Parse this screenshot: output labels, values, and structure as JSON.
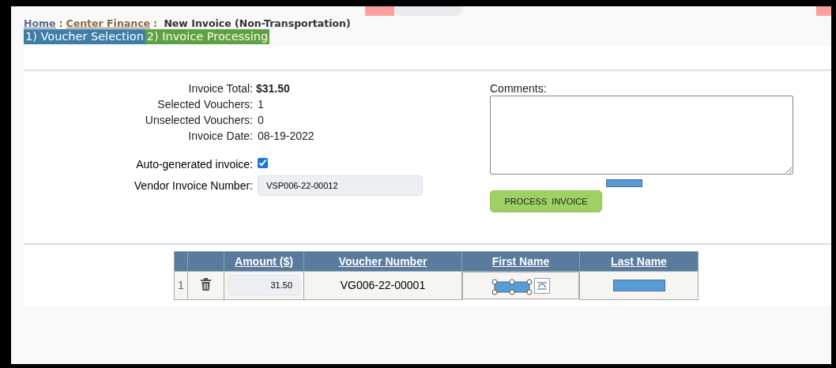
{
  "breadcrumb": {
    "links": [
      "Home",
      "Center Finance"
    ],
    "separator": ":",
    "current": "New Invoice (Non-Transportation)"
  },
  "steps": [
    {
      "label": "1) Voucher Selection",
      "selected": false
    },
    {
      "label": "2) Invoice Processing",
      "selected": true
    }
  ],
  "summary": [
    {
      "label": "Invoice Total:",
      "value": "$31.50",
      "kind": "bold"
    },
    {
      "label": "Selected Vouchers:",
      "value": "1",
      "kind": "plain"
    },
    {
      "label": "Unselected Vouchers:",
      "value": "0",
      "kind": "plain"
    },
    {
      "label": "Invoice Date:",
      "value": "08-19-2022",
      "kind": "plain"
    }
  ],
  "auto_generated": {
    "label": "Auto-generated invoice:",
    "checked": true
  },
  "vendor_invoice": {
    "label": "Vendor Invoice Number:",
    "value": "VSP006-22-00012"
  },
  "comments": {
    "label": "Comments:"
  },
  "process_button": "PROCESS  INVOICE",
  "table": {
    "columns": [
      "Amount ($)",
      "Voucher Number",
      "First Name",
      "Last Name"
    ],
    "rows": [
      {
        "index": "1",
        "amount": "31.50",
        "voucher": "VG006-22-00001"
      }
    ]
  }
}
